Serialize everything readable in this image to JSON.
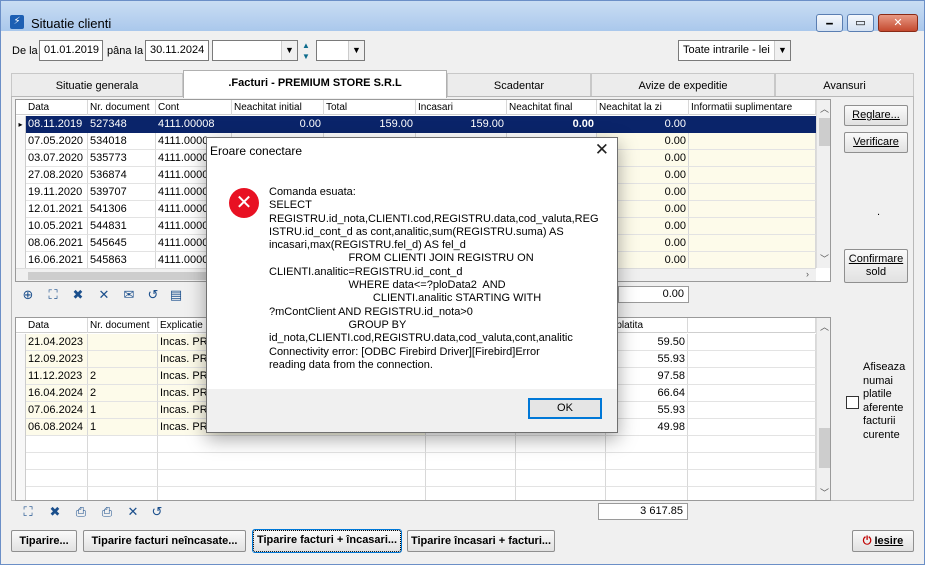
{
  "window": {
    "title": "Situatie clienti",
    "min_glyph": "🗕",
    "max_glyph": "▭",
    "close_glyph": "✕"
  },
  "filters": {
    "from_label": "De la",
    "from_value": "01.01.2019",
    "to_label": "pâna la",
    "to_value": "30.11.2024",
    "combo1_value": "",
    "combo2_value": "",
    "entries_value": "Toate intrarile - lei"
  },
  "tabs": [
    "Situatie generala",
    ".Facturi - PREMIUM STORE S.R.L",
    "Scadentar",
    "Avize de expeditie",
    "Avansuri"
  ],
  "invoices": {
    "columns": [
      "Data",
      "Nr. document",
      "Cont",
      "Neachitat initial",
      "Total",
      "Incasari",
      "Neachitat final",
      "Neachitat la zi",
      "Informatii suplimentare"
    ],
    "rows": [
      [
        "08.11.2019",
        "527348",
        "4111.00008",
        "0.00",
        "159.00",
        "159.00",
        "0.00",
        "0.00",
        ""
      ],
      [
        "07.05.2020",
        "534018",
        "4111.0000",
        "",
        "",
        "",
        "",
        "0.00",
        ""
      ],
      [
        "03.07.2020",
        "535773",
        "4111.0000",
        "",
        "",
        "",
        "",
        "0.00",
        ""
      ],
      [
        "27.08.2020",
        "536874",
        "4111.0000",
        "",
        "",
        "",
        "",
        "0.00",
        ""
      ],
      [
        "19.11.2020",
        "539707",
        "4111.0000",
        "",
        "",
        "",
        "",
        "0.00",
        ""
      ],
      [
        "12.01.2021",
        "541306",
        "4111.0000",
        "",
        "",
        "",
        "",
        "0.00",
        ""
      ],
      [
        "10.05.2021",
        "544831",
        "4111.0000",
        "",
        "",
        "",
        "",
        "0.00",
        ""
      ],
      [
        "08.06.2021",
        "545645",
        "4111.0000",
        "",
        "",
        "",
        "",
        "0.00",
        ""
      ],
      [
        "16.06.2021",
        "545863",
        "4111.0000",
        "",
        "",
        "",
        "",
        "0.00",
        ""
      ]
    ],
    "total": "0.00"
  },
  "payments": {
    "columns": [
      "Data",
      "Nr. document",
      "Explicatie",
      "a platita"
    ],
    "rows": [
      [
        "21.04.2023",
        "",
        "Incas. PRE",
        "59.50"
      ],
      [
        "12.09.2023",
        "",
        "Incas. PRE",
        "55.93"
      ],
      [
        "11.12.2023",
        "2",
        "Incas. PRE",
        "97.58"
      ],
      [
        "16.04.2024",
        "2",
        "Incas. PRE",
        "66.64"
      ],
      [
        "07.06.2024",
        "1",
        "Incas. PRE",
        "55.93"
      ],
      [
        "06.08.2024",
        "1",
        "Incas. PRE",
        "49.98"
      ]
    ],
    "total": "3 617.85"
  },
  "side_buttons": {
    "reglare": "Reglare...",
    "verificare": "Verificare",
    "dot": ".",
    "confirmare_line1": "Confirmare",
    "confirmare_line2": "sold"
  },
  "checkbox": {
    "lines": [
      "Afiseaza",
      "numai",
      "platile",
      "aferente",
      "facturii",
      "curente"
    ]
  },
  "bottom_buttons": {
    "tiparire": "Tiparire...",
    "tiparire_neincasate": "Tiparire facturi neîncasate...",
    "tiparire_facturi_incasari": "Tiparire facturi + încasari...",
    "tiparire_incasari_facturi": "Tiparire încasari + facturi...",
    "iesire": "Iesire"
  },
  "dialog": {
    "title": "Eroare conectare",
    "message": "Comanda esuata:\nSELECT\nREGISTRU.id_nota,CLIENTI.cod,REGISTRU.data,cod_valuta,REG\nISTRU.id_cont_d as cont,analitic,sum(REGISTRU.suma) AS\nincasari,max(REGISTRU.fel_d) AS fel_d\n                          FROM CLIENTI JOIN REGISTRU ON\nCLIENTI.analitic=REGISTRU.id_cont_d\n                          WHERE data<=?ploData2  AND\n                                  CLIENTI.analitic STARTING WITH\n?mContClient AND REGISTRU.id_nota>0\n                          GROUP BY\nid_nota,CLIENTI.cod,REGISTRU.data,cod_valuta,cont,analitic\nConnectivity error: [ODBC Firebird Driver][Firebird]Error\nreading data from the connection.",
    "ok_label": "OK",
    "error_glyph": "✕",
    "close_glyph": "✕"
  },
  "colors": {
    "selection": "#0a246a",
    "error_red": "#e81123",
    "accent_blue": "#0078d7"
  }
}
